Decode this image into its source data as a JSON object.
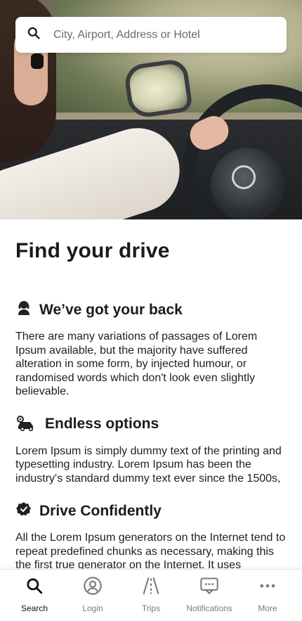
{
  "search": {
    "placeholder": "City, Airport, Address or Hotel"
  },
  "main": {
    "title": "Find your drive",
    "sections": [
      {
        "icon": "support-agent-icon",
        "title": "We’ve got your back",
        "text": "There are many variations of passages of Lorem Ipsum available, but the majority have suffered alteration in some form, by injected humour, or randomised words which don't look even slightly believable."
      },
      {
        "icon": "car-options-icon",
        "title": "Endless options",
        "text": "Lorem Ipsum is simply dummy text of the printing and typesetting industry. Lorem Ipsum has been the industry's standard dummy text ever since the 1500s,"
      },
      {
        "icon": "verified-badge-icon",
        "title": "Drive Confidently",
        "text": "All the Lorem Ipsum generators on the Internet tend to repeat predefined chunks as necessary, making this the first true generator on the Internet. It uses"
      }
    ]
  },
  "bottom_nav": {
    "items": [
      {
        "label": "Search",
        "icon": "search-icon",
        "active": true
      },
      {
        "label": "Login",
        "icon": "user-circle-icon",
        "active": false
      },
      {
        "label": "Trips",
        "icon": "road-icon",
        "active": false
      },
      {
        "label": "Notifications",
        "icon": "chat-dots-icon",
        "active": false
      },
      {
        "label": "More",
        "icon": "more-dots-icon",
        "active": false
      }
    ]
  },
  "colors": {
    "text": "#1b1b1b",
    "muted": "#7b7b7b",
    "active": "#111111"
  }
}
